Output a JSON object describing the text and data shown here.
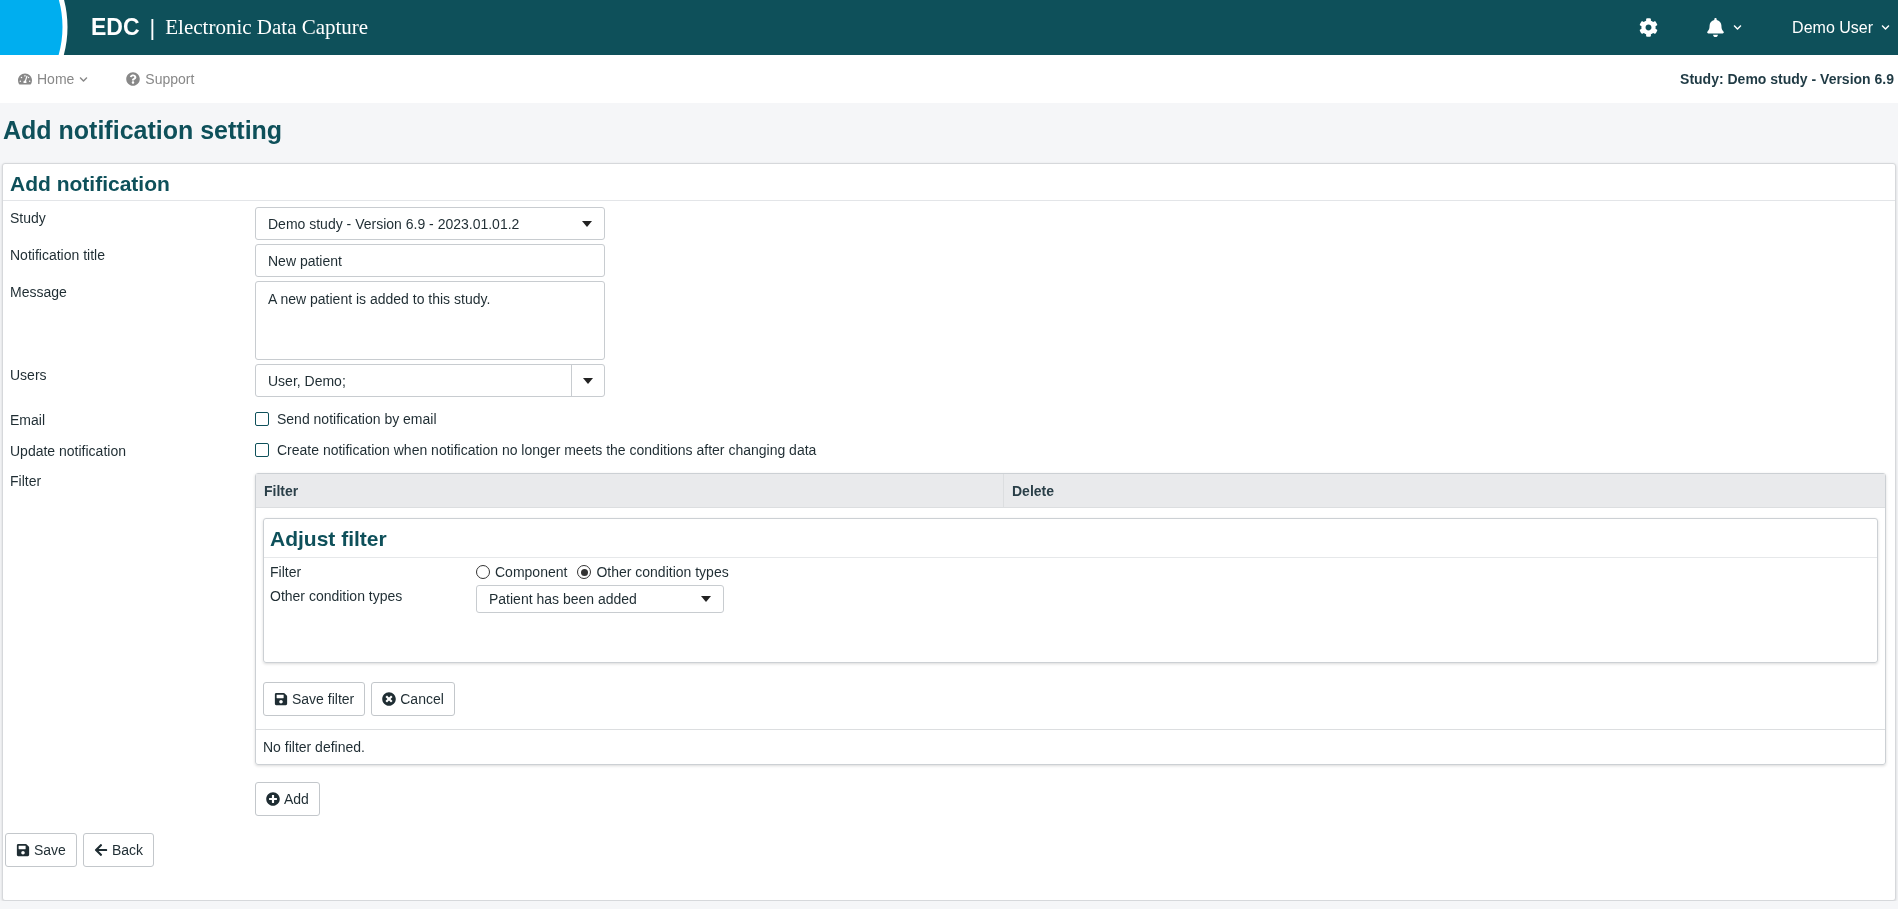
{
  "header": {
    "logo_abbr": "EDC",
    "separator": "|",
    "app_title": "Electronic Data Capture",
    "user_name": "Demo User"
  },
  "nav": {
    "items": [
      {
        "label": "Home",
        "kind": "menu"
      },
      {
        "label": "Support",
        "kind": "help"
      }
    ],
    "study_label": "Study: Demo study - Version 6.9"
  },
  "page_title": "Add notification setting",
  "form": {
    "title": "Add notification",
    "fields": [
      {
        "kind": "select",
        "label": "Study",
        "value": "Demo study - Version 6.9 - 2023.01.01.2"
      },
      {
        "kind": "text",
        "label": "Notification title",
        "value": "New patient"
      },
      {
        "kind": "textarea",
        "label": "Message",
        "value": "A new patient is added to this study."
      },
      {
        "kind": "combo",
        "label": "Users",
        "value": "User, Demo;"
      },
      {
        "kind": "checkbox",
        "label": "Email",
        "text": "Send notification by email",
        "checked": false
      },
      {
        "kind": "checkbox",
        "label": "Update notification",
        "text": "Create notification when notification no longer meets the conditions after changing data",
        "checked": false
      }
    ],
    "filter": {
      "label": "Filter",
      "columns": [
        "Filter",
        "Delete"
      ],
      "adjust": {
        "title": "Adjust filter",
        "filter_label": "Filter",
        "radios": [
          {
            "label": "Component",
            "selected": false
          },
          {
            "label": "Other condition types",
            "selected": true
          }
        ],
        "condition_label": "Other condition types",
        "condition_value": "Patient has been added",
        "buttons": [
          {
            "label": "Save filter",
            "kind": "save"
          },
          {
            "label": "Cancel",
            "kind": "cancel"
          }
        ]
      },
      "empty_text": "No filter defined.",
      "add_button": {
        "label": "Add",
        "kind": "add"
      }
    },
    "actions": [
      {
        "label": "Save",
        "kind": "save"
      },
      {
        "label": "Back",
        "kind": "back"
      }
    ]
  }
}
